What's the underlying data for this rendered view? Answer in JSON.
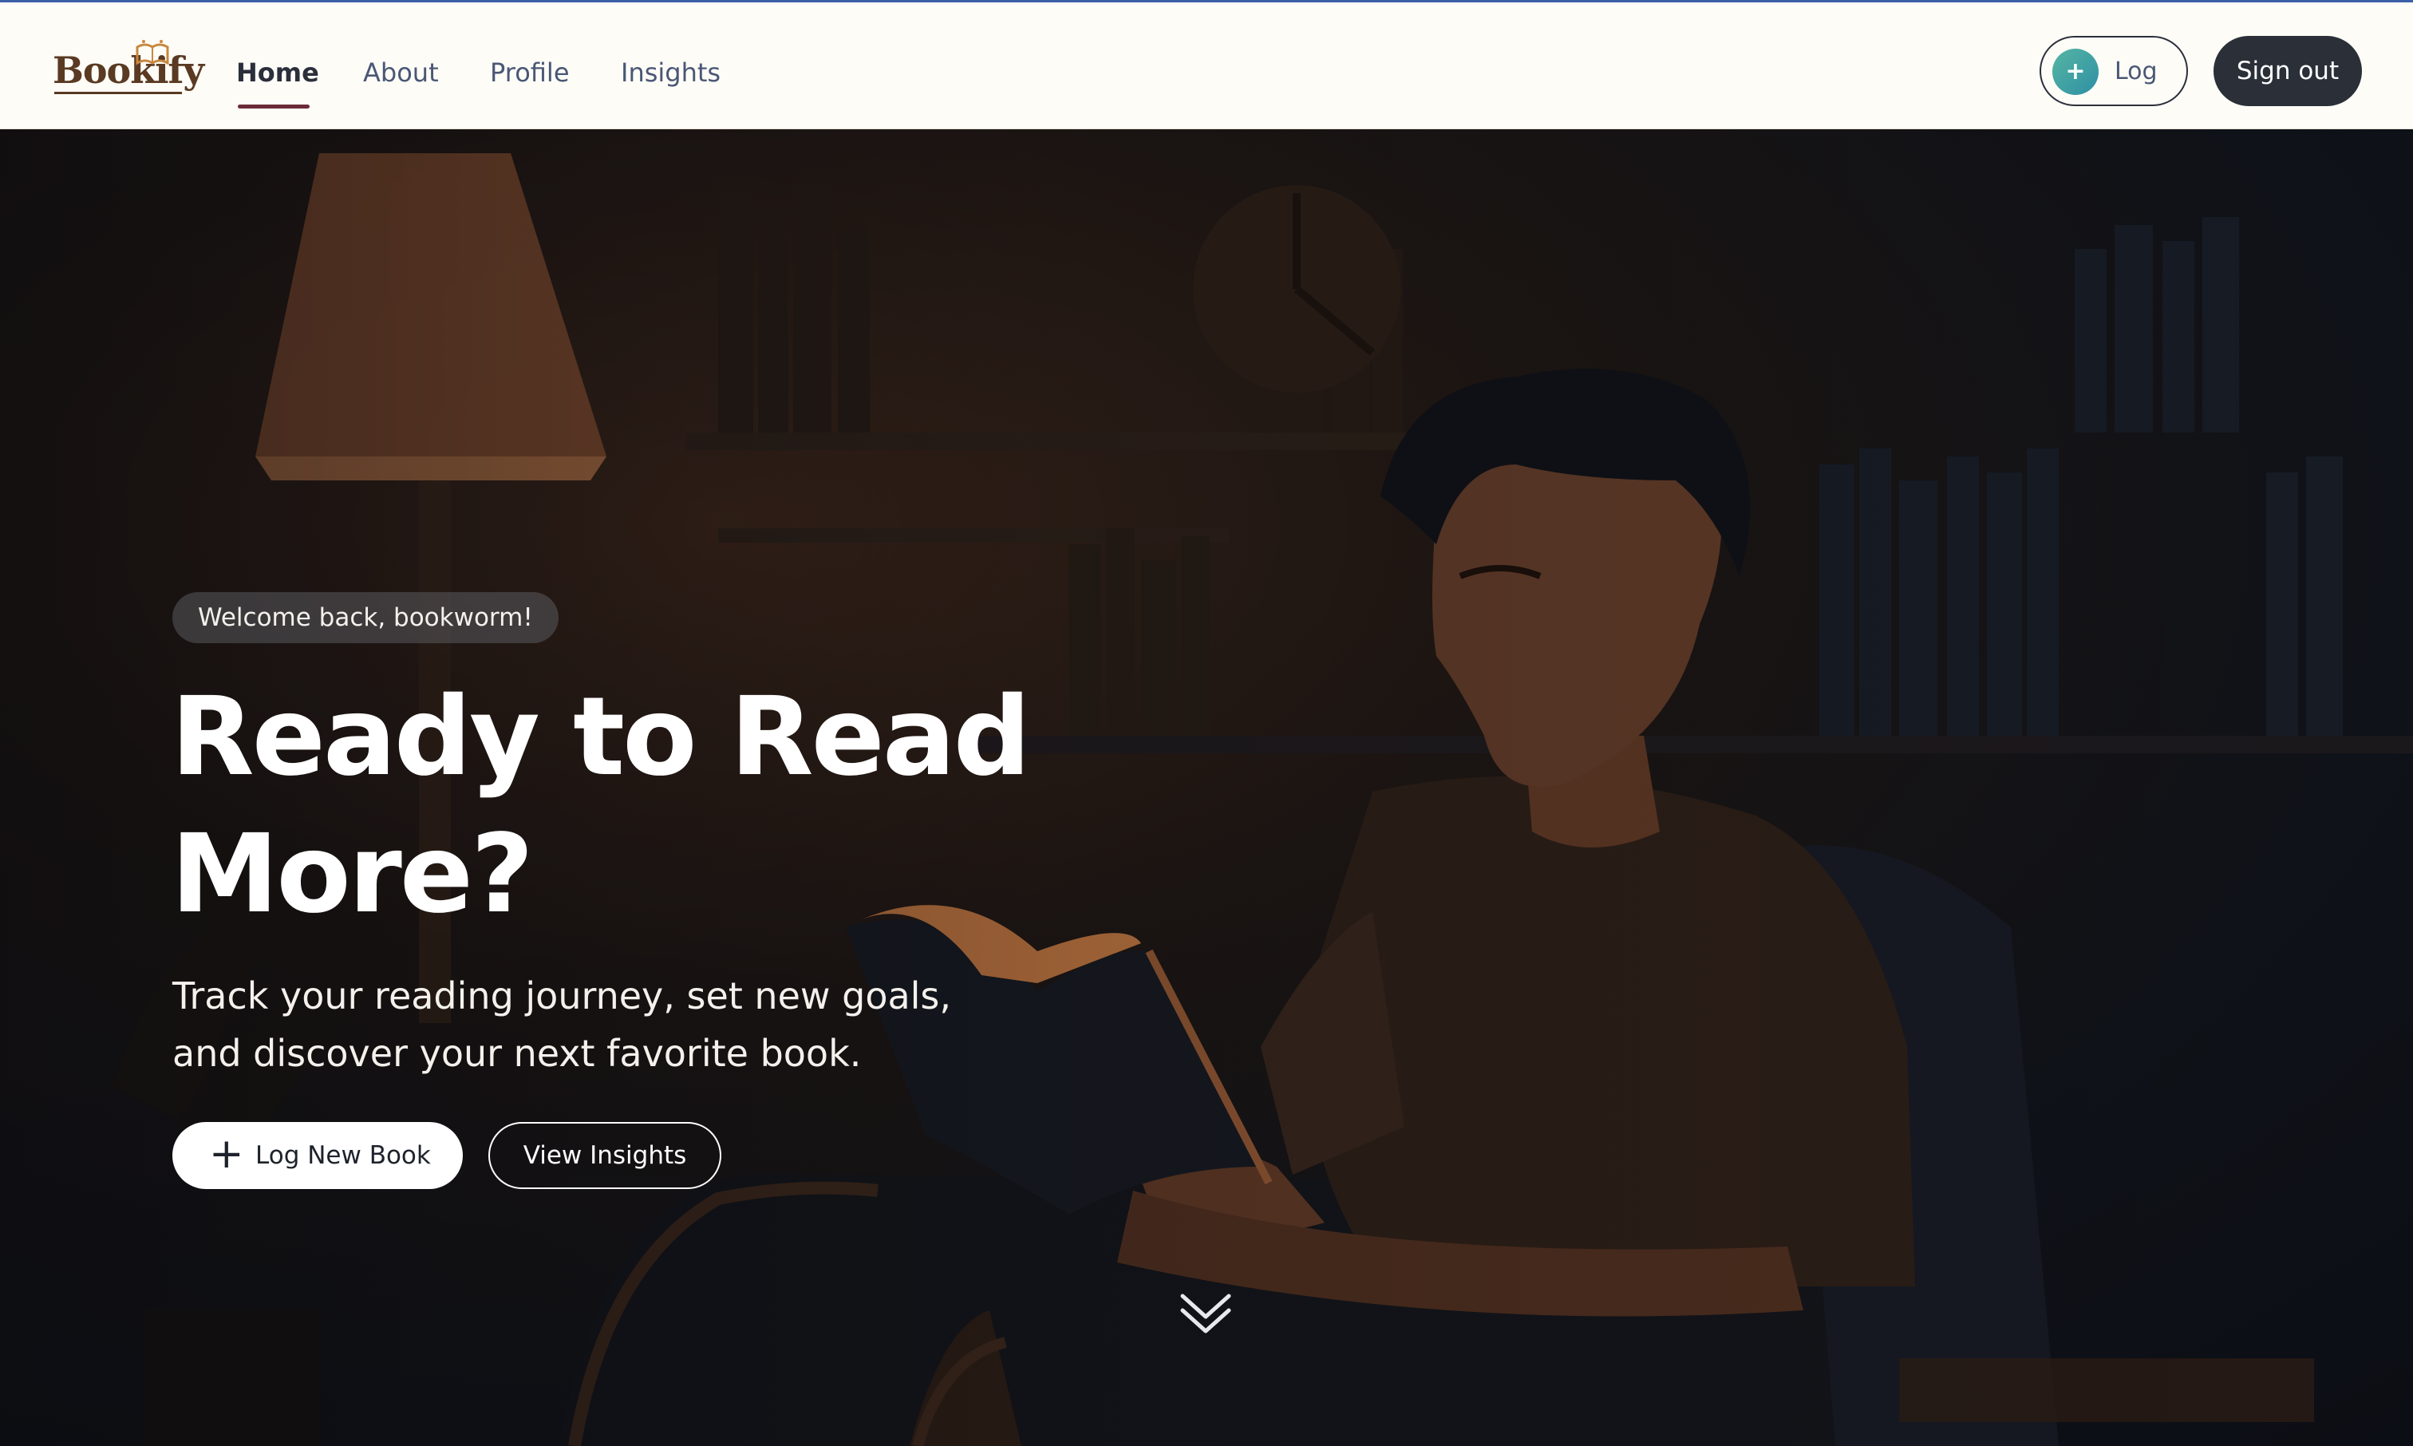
{
  "brand": {
    "name": "Bookify"
  },
  "nav": {
    "links": [
      {
        "label": "Home",
        "active": true
      },
      {
        "label": "About",
        "active": false
      },
      {
        "label": "Profile",
        "active": false
      },
      {
        "label": "Insights",
        "active": false
      }
    ],
    "log_button": {
      "icon": "plus-icon",
      "label": "Log"
    },
    "signout_label": "Sign out"
  },
  "hero": {
    "welcome": "Welcome back, bookworm!",
    "headline_line1": "Ready to Read",
    "headline_line2": "More?",
    "subtext_line1": "Track your reading journey, set new goals,",
    "subtext_line2": "and discover your next favorite book.",
    "primary_button": {
      "icon": "plus-icon",
      "label": "Log New Book"
    },
    "secondary_button": {
      "label": "View Insights"
    },
    "scroll_icon": "double-chevron-down-icon"
  },
  "colors": {
    "nav_bg": "#fdfcf7",
    "brand_brown": "#5a3a22",
    "active_underline": "#6b2c38",
    "signout_bg": "#2a2f38",
    "log_accent": "#2e8fa4"
  }
}
